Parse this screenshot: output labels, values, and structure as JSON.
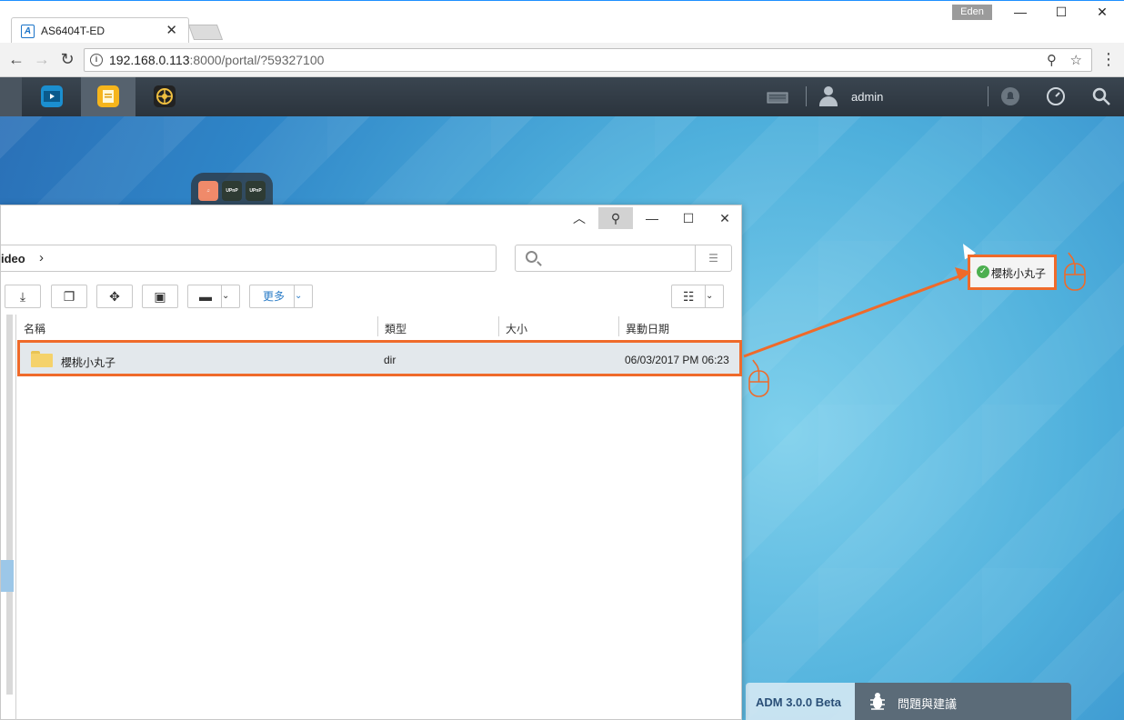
{
  "browser": {
    "tab_title": "AS6404T-ED",
    "tab_favicon": "AS-logo-icon",
    "profile_name": "Eden",
    "url_host": "192.168.0.113",
    "url_path": ":8000/portal/?59327100",
    "accent": "#1a73c8"
  },
  "taskbar": {
    "apps": [
      "video-app-icon",
      "file-explorer-icon",
      "app-central-icon"
    ],
    "user": "admin"
  },
  "dock": {
    "items": [
      {
        "name": "music-app-icon",
        "label": "♫"
      },
      {
        "name": "upnp-icon-1",
        "label": "UPnP"
      },
      {
        "name": "upnp-icon-2",
        "label": "UPnP"
      }
    ]
  },
  "explorer": {
    "breadcrumb": "ideo",
    "more_label": "更多",
    "columns": [
      "名稱",
      "類型",
      "大小",
      "異動日期"
    ],
    "rows": [
      {
        "name": "櫻桃小丸子",
        "type": "dir",
        "size": "",
        "modified": "06/03/2017 PM 06:23"
      }
    ]
  },
  "desktop": {
    "dropped_item": "櫻桃小丸子",
    "highlight_color": "#ef6a2a"
  },
  "footer": {
    "version": "ADM 3.0.0 Beta",
    "feedback": "問題與建議"
  }
}
